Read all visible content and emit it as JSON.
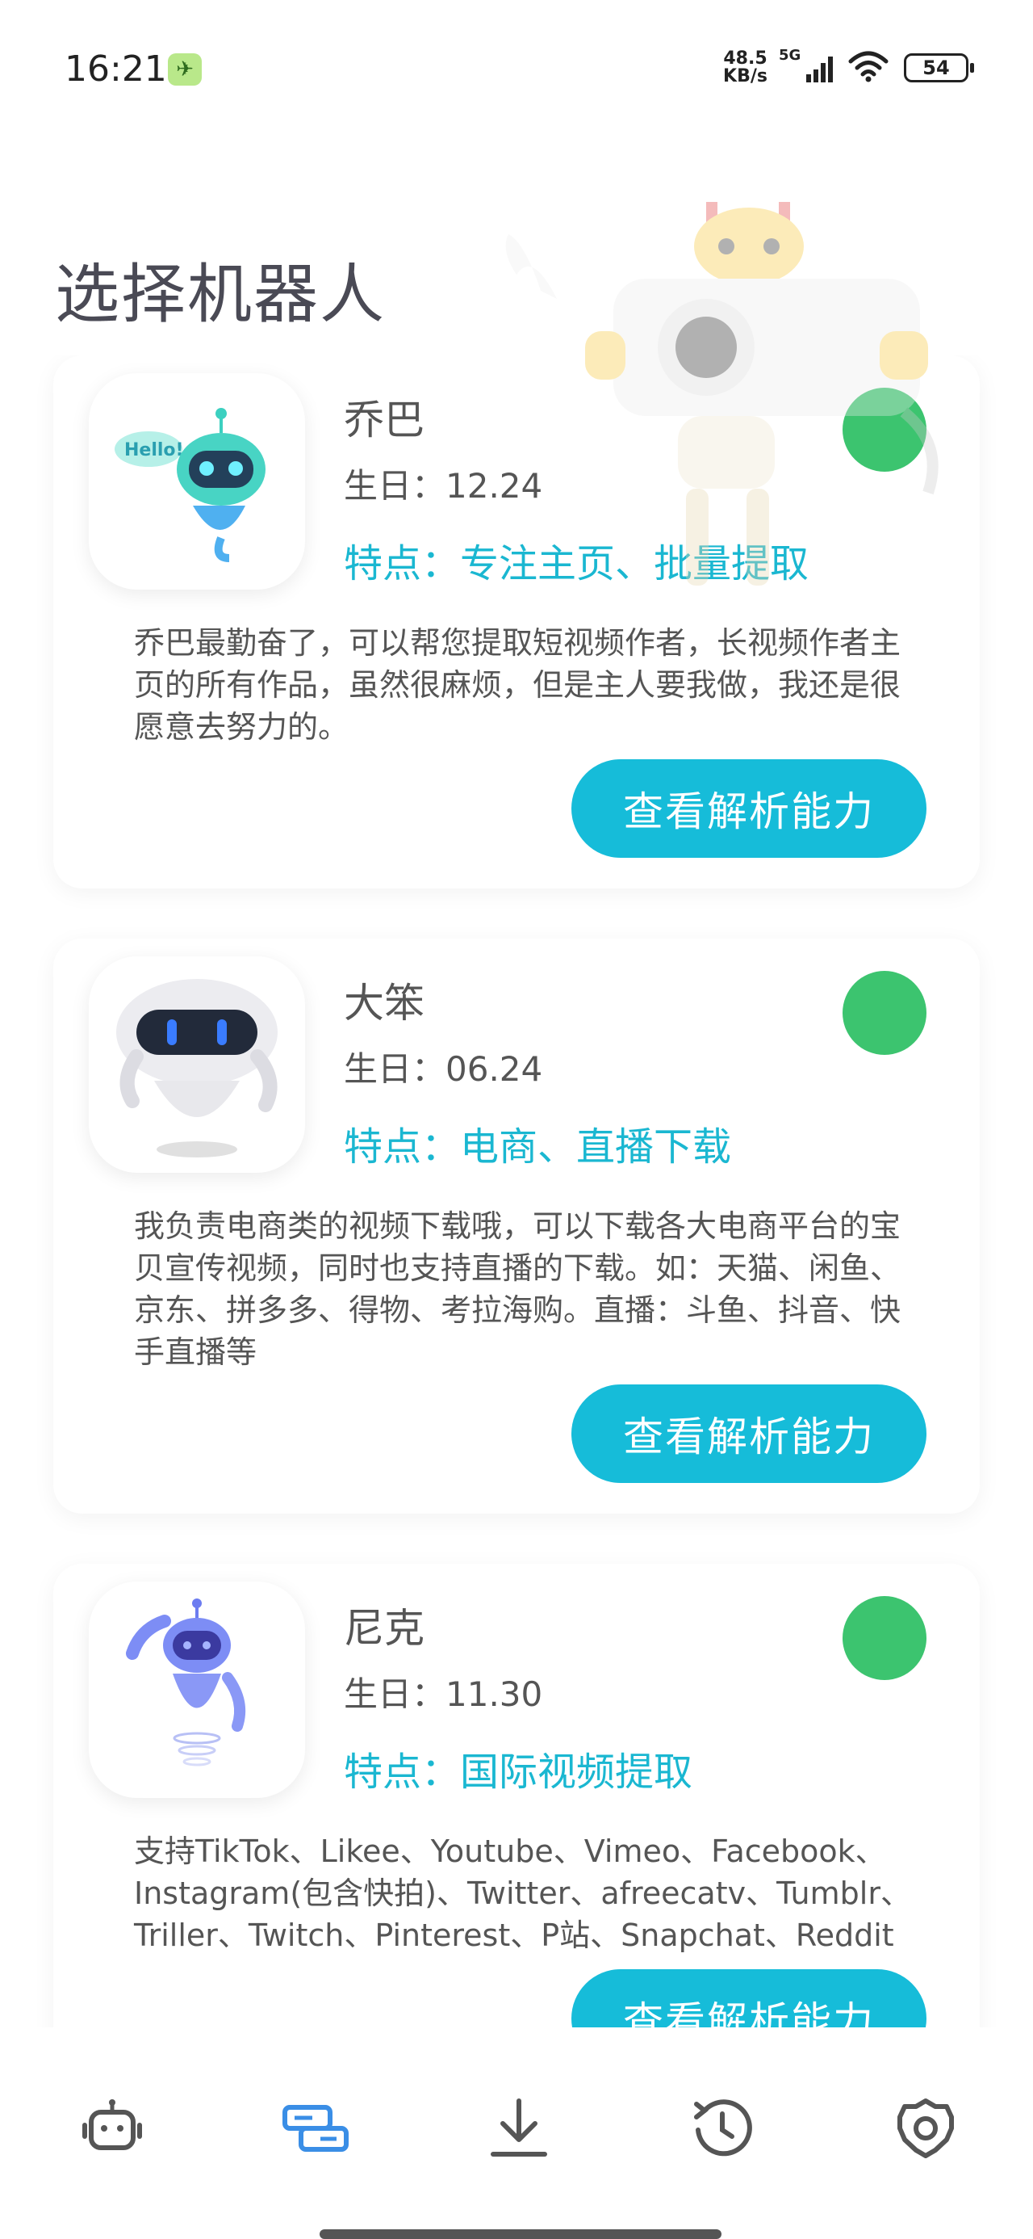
{
  "status_bar": {
    "time": "16:21",
    "speed_value": "48.5",
    "speed_unit": "KB/s",
    "network": "5G",
    "battery": "54"
  },
  "page": {
    "title": "选择机器人"
  },
  "robots": [
    {
      "name": "乔巴",
      "birthday": "生日：12.24",
      "feature": "特点：专注主页、批量提取",
      "description": "乔巴最勤奋了，可以帮您提取短视频作者，长视频作者主页的所有作品，虽然很麻烦，但是主人要我做，我还是很愿意去努力的。",
      "button_label": "查看解析能力",
      "avatar_text": "Hello!",
      "status_color": "#3cc46f"
    },
    {
      "name": "大笨",
      "birthday": "生日：06.24",
      "feature": "特点：电商、直播下载",
      "description": "我负责电商类的视频下载哦，可以下载各大电商平台的宝贝宣传视频，同时也支持直播的下载。如：天猫、闲鱼、京东、拼多多、得物、考拉海购。直播：斗鱼、抖音、快手直播等",
      "button_label": "查看解析能力",
      "status_color": "#3cc46f"
    },
    {
      "name": "尼克",
      "birthday": "生日：11.30",
      "feature": "特点：国际视频提取",
      "description": "支持TikTok、Likee、Youtube、Vimeo、Facebook、Instagram(包含快拍)、Twitter、afreecatv、Tumblr、Triller、Twitch、Pinterest、P站、Snapchat、Reddit",
      "button_label": "查看解析能力",
      "status_color": "#3cc46f"
    }
  ],
  "bottom_nav": [
    {
      "icon": "robot-icon",
      "active": false
    },
    {
      "icon": "link-cards-icon",
      "active": true
    },
    {
      "icon": "download-icon",
      "active": false
    },
    {
      "icon": "history-icon",
      "active": false
    },
    {
      "icon": "settings-icon",
      "active": false
    }
  ],
  "colors": {
    "accent": "#16bcd9",
    "feature_text": "#1ab7d1",
    "status_green": "#3cc46f",
    "nav_active": "#3a8ee6",
    "nav_inactive": "#555555"
  }
}
